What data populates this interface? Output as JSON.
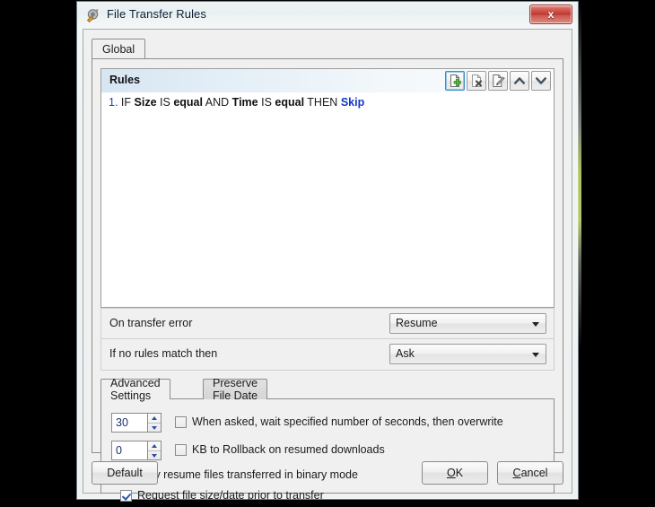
{
  "window": {
    "title": "File Transfer Rules",
    "icon": "satellite-dish-icon",
    "close_label": "x"
  },
  "tabs": {
    "global_label": "Global"
  },
  "rules_panel": {
    "header_label": "Rules",
    "toolbar": [
      {
        "name": "add-rule-button",
        "icon": "page-add-icon",
        "focused": true,
        "enabled": true
      },
      {
        "name": "delete-rule-button",
        "icon": "page-delete-icon",
        "focused": false,
        "enabled": false
      },
      {
        "name": "edit-rule-button",
        "icon": "page-edit-icon",
        "focused": false,
        "enabled": true
      },
      {
        "name": "move-up-button",
        "icon": "chevron-up-icon",
        "focused": false,
        "enabled": true
      },
      {
        "name": "move-down-button",
        "icon": "chevron-down-icon",
        "focused": false,
        "enabled": true
      }
    ],
    "rules": [
      {
        "number": "1.",
        "if_kw": "IF",
        "cond1_field": "Size",
        "cond1_op_kw": "IS",
        "cond1_value": "equal",
        "joiner": "AND",
        "cond2_field": "Time",
        "cond2_op_kw": "IS",
        "cond2_value": "equal",
        "then_kw": "THEN",
        "action": "Skip"
      }
    ]
  },
  "options": {
    "transfer_error_label": "On transfer error",
    "transfer_error_value": "Resume",
    "no_rules_match_label": "If no rules match then",
    "no_rules_match_value": "Ask"
  },
  "advanced": {
    "tab_advanced_label": "Advanced Settings",
    "tab_preserve_label": "Preserve File Date",
    "wait_seconds_value": "30",
    "wait_seconds_label": "When asked, wait specified number of seconds, then overwrite",
    "wait_seconds_checked": false,
    "rollback_kb_value": "0",
    "rollback_kb_label": "KB to Rollback on resumed downloads",
    "rollback_kb_checked": false,
    "binary_resume_label": "Only resume files transferred in binary mode",
    "binary_resume_checked": true,
    "request_size_label": "Request file size/date prior to transfer",
    "request_size_checked": true
  },
  "footer": {
    "default_label": "Default",
    "ok_mnemonic": "O",
    "ok_rest": "K",
    "cancel_mnemonic": "C",
    "cancel_rest": "ancel"
  },
  "colors": {
    "accent_blue": "#1642b4",
    "action_blue": "#1437c7",
    "close_red": "#bb362c",
    "add_green": "#4cb037",
    "delete_red": "#5a5a5a",
    "dialog_bg": "#f0f0f0"
  }
}
